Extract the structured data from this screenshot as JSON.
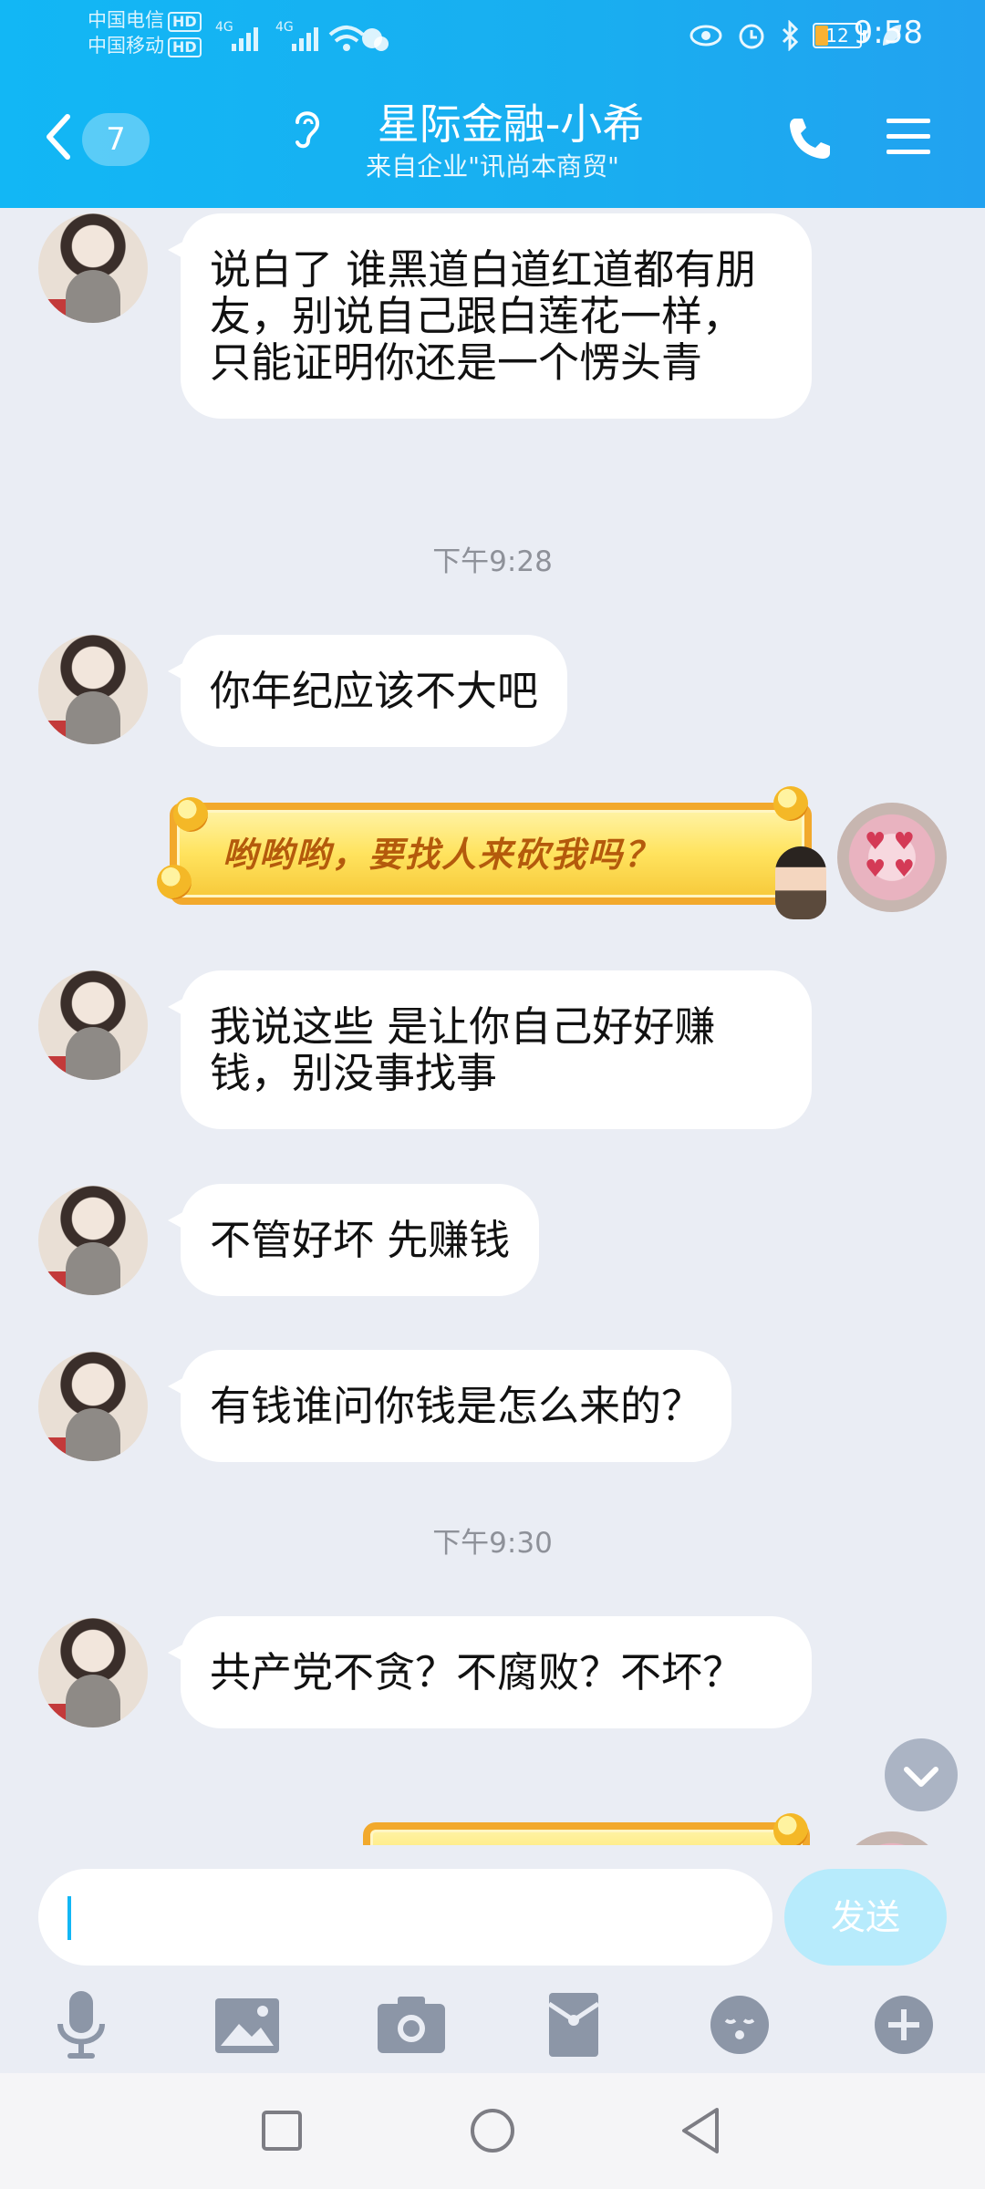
{
  "status_bar": {
    "carrier1": "中国电信",
    "carrier2": "中国移动",
    "hd": "HD",
    "net": "4G",
    "battery": "12",
    "time": "9:58"
  },
  "header": {
    "unread_count": "7",
    "title": "星际金融-小希",
    "subtitle": "来自企业\"讯尚本商贸\""
  },
  "messages": [
    {
      "side": "left",
      "text": "说白了 谁黑道白道红道都有朋友，别说自己跟白莲花一样，只能证明你还是一个愣头青"
    },
    {
      "type": "timestamp",
      "text": "下午9:28"
    },
    {
      "side": "left",
      "text": "你年纪应该不大吧"
    },
    {
      "side": "right",
      "style": "gold",
      "text": "哟哟哟，要找人来砍我吗？"
    },
    {
      "side": "left",
      "text": "我说这些 是让你自己好好赚钱，别没事找事"
    },
    {
      "side": "left",
      "text": "不管好坏 先赚钱"
    },
    {
      "side": "left",
      "text": "有钱谁问你钱是怎么来的？"
    },
    {
      "type": "timestamp",
      "text": "下午9:30"
    },
    {
      "side": "left",
      "text": "共产党不贪？不腐败？不坏？"
    }
  ],
  "input": {
    "value": "",
    "send_label": "发送"
  },
  "toolbar_icons": [
    "microphone-icon",
    "image-icon",
    "camera-icon",
    "red-packet-icon",
    "emoji-icon",
    "plus-icon"
  ],
  "colors": {
    "header": "#12b7f5",
    "background": "#eaedf4",
    "send_disabled": "#b7ebfc"
  }
}
